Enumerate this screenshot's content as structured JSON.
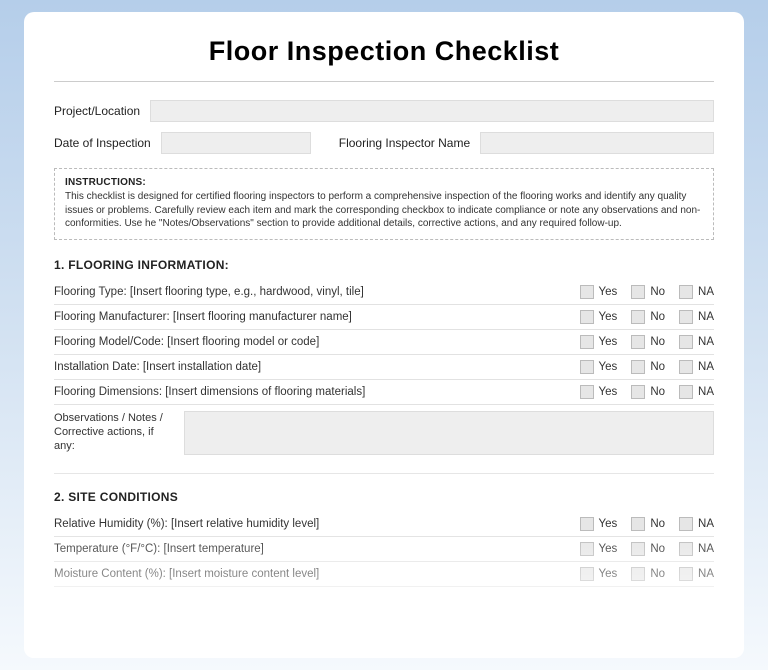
{
  "title": "Floor Inspection Checklist",
  "fields": {
    "project_label": "Project/Location",
    "date_label": "Date of Inspection",
    "inspector_label": "Flooring Inspector Name"
  },
  "instructions": {
    "heading": "INSTRUCTIONS:",
    "body": "This checklist is designed for certified flooring inspectors to perform a comprehensive inspection of the flooring works and identify any quality issues or problems. Carefully review each item and mark the corresponding checkbox to indicate compliance or note any observations and non-conformities. Use he \"Notes/Observations\" section to provide additional details, corrective actions, and any required follow-up."
  },
  "check_options": {
    "yes": "Yes",
    "no": "No",
    "na": "NA"
  },
  "notes_label": "Observations / Notes / Corrective actions, if any:",
  "section1": {
    "heading": "1. FLOORING INFORMATION:",
    "items": [
      "Flooring Type: [Insert flooring type, e.g., hardwood, vinyl, tile]",
      "Flooring Manufacturer: [Insert flooring manufacturer name]",
      "Flooring Model/Code: [Insert flooring model or code]",
      "Installation Date: [Insert installation date]",
      "Flooring Dimensions: [Insert dimensions of flooring materials]"
    ]
  },
  "section2": {
    "heading": "2. SITE CONDITIONS",
    "items": [
      "Relative Humidity (%): [Insert relative humidity level]",
      "Temperature (°F/°C): [Insert temperature]",
      "Moisture Content (%): [Insert moisture content level]"
    ]
  }
}
